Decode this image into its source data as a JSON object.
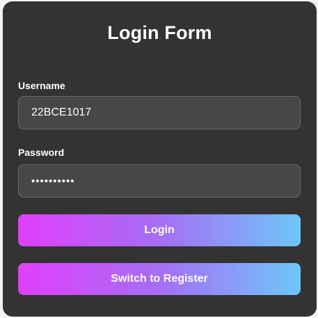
{
  "form": {
    "title": "Login Form",
    "username": {
      "label": "Username",
      "value": "22BCE1017"
    },
    "password": {
      "label": "Password",
      "value": "••••••••••"
    },
    "login_button": "Login",
    "switch_button": "Switch to Register"
  },
  "colors": {
    "card_background": "#333333",
    "input_background": "#474747",
    "gradient_start": "#e040fb",
    "gradient_end": "#6ec6f9"
  }
}
